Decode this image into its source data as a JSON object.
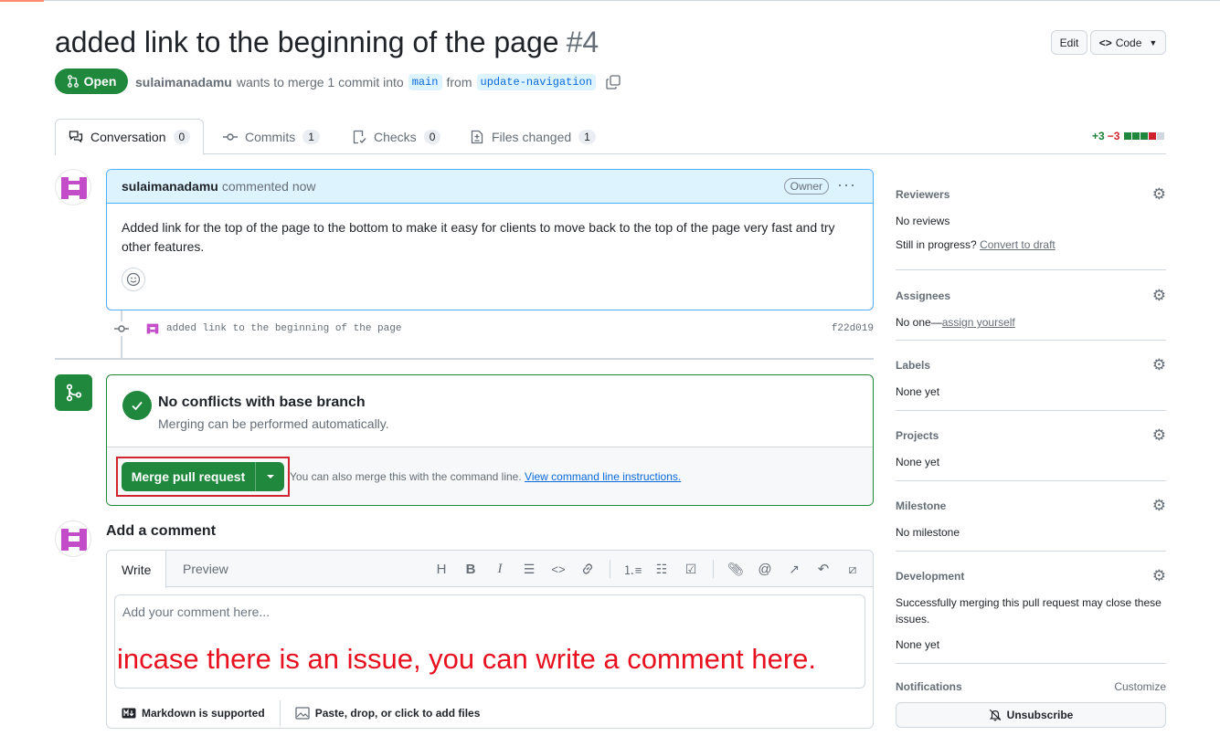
{
  "pr": {
    "title": "added link to the beginning of the page",
    "number": "#4",
    "state": "Open",
    "author": "sulaimanadamu",
    "merge_text": "wants to merge 1 commit into",
    "base_branch": "main",
    "from_text": "from",
    "head_branch": "update-navigation"
  },
  "header_buttons": {
    "edit": "Edit",
    "code": "Code"
  },
  "tabs": [
    {
      "label": "Conversation",
      "count": "0"
    },
    {
      "label": "Commits",
      "count": "1"
    },
    {
      "label": "Checks",
      "count": "0"
    },
    {
      "label": "Files changed",
      "count": "1"
    }
  ],
  "diffstat": {
    "additions": "+3",
    "deletions": "−3"
  },
  "comment": {
    "author": "sulaimanadamu",
    "time": "commented now",
    "badge": "Owner",
    "body": "Added link for the top of the page to the bottom to make it easy for clients to move back to the top of the page very fast and try other features."
  },
  "commit": {
    "message": "added link to the beginning of the page",
    "sha": "f22d019"
  },
  "merge": {
    "title": "No conflicts with base branch",
    "subtitle": "Merging can be performed automatically.",
    "button": "Merge pull request",
    "help_text": "You can also merge this with the command line.",
    "help_link": "View command line instructions."
  },
  "new_comment": {
    "title": "Add a comment",
    "tab_write": "Write",
    "tab_preview": "Preview",
    "placeholder": "Add your comment here...",
    "annotation": "incase there is an issue, you can write a comment here.",
    "markdown_note": "Markdown is supported",
    "attach_note": "Paste, drop, or click to add files"
  },
  "sidebar": {
    "reviewers": {
      "label": "Reviewers",
      "value": "No reviews",
      "draft_prefix": "Still in progress?",
      "draft_link": "Convert to draft"
    },
    "assignees": {
      "label": "Assignees",
      "value": "No one—",
      "link": "assign yourself"
    },
    "labels": {
      "label": "Labels",
      "value": "None yet"
    },
    "projects": {
      "label": "Projects",
      "value": "None yet"
    },
    "milestone": {
      "label": "Milestone",
      "value": "No milestone"
    },
    "development": {
      "label": "Development",
      "value": "Successfully merging this pull request may close these issues.",
      "value2": "None yet"
    },
    "notifications": {
      "label": "Notifications",
      "customize": "Customize",
      "button": "Unsubscribe"
    }
  },
  "colors": {
    "green": "#1f883d",
    "blue_accent": "#0969da",
    "annotation_red": "#e8111f",
    "highlight_box": "#d1242f"
  }
}
